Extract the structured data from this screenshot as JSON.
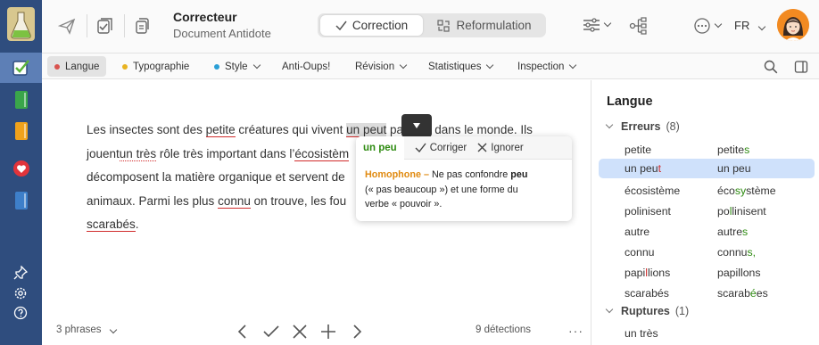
{
  "app": {
    "title": "Correcteur",
    "subtitle": "Document Antidote",
    "language": "FR",
    "accent": "#2f4d7e"
  },
  "modes": {
    "correction": "Correction",
    "reformulation": "Reformulation"
  },
  "tabs": [
    {
      "label": "Langue",
      "dot": "#d9534f",
      "dropdown": false
    },
    {
      "label": "Typographie",
      "dot": "#e8b321",
      "dropdown": false
    },
    {
      "label": "Style",
      "dot": "#2a9fd6",
      "dropdown": true
    },
    {
      "label": "Anti-Oups!",
      "dot": "",
      "dropdown": false
    },
    {
      "label": "Révision",
      "dot": "",
      "dropdown": true
    },
    {
      "label": "Statistiques",
      "dot": "",
      "dropdown": true
    },
    {
      "label": "Inspection",
      "dot": "",
      "dropdown": true
    }
  ],
  "text": {
    "s1": "Les insectes sont des ",
    "w_petite": "petite",
    "s2": " créatures qui vivent ",
    "w_unpeut": "un peut",
    "s3": " pa",
    "s3b": "tout dans le monde. Ils",
    "s4": "jouent",
    "w_untres": "un très",
    "s5": " rôle très important dans l’",
    "w_ecosisteme": "écosistèm",
    "s6": "décomposent la matière organique et servent de",
    "s7": "animaux. Parmi les plus ",
    "w_connu": "connu",
    "s8": " on trouve, les fou",
    "w_scarabes": "scarabés",
    "s9": "."
  },
  "popup": {
    "suggestion": "un peu",
    "fix": "Corriger",
    "ignore": "Ignorer",
    "kind": "Homophone –",
    "msg1": " Ne pas confondre ",
    "msg_word": "peu",
    "msg2": "(« pas beaucoup ») et une forme du",
    "msg3": "verbe « pouvoir »."
  },
  "footer": {
    "phrases": "3 phrases",
    "detections": "9 détections",
    "more": "···"
  },
  "panel": {
    "title": "Langue",
    "errors_label": "Erreurs",
    "errors_count": "(8)",
    "breaks_label": "Ruptures",
    "breaks_count": "(1)",
    "rows": [
      {
        "a": "petite",
        "b_pre": "petite",
        "b_hl": "s",
        "b_post": ""
      },
      {
        "a_pre": "un peu",
        "a_hl": "t",
        "b": "un peu"
      },
      {
        "a": "écosistème",
        "b_pre": "éco",
        "b_hl": "sy",
        "b_post": "stème"
      },
      {
        "a": "polinisent",
        "b_pre": "po",
        "b_hl": "l",
        "b_post": "linisent"
      },
      {
        "a": "autre",
        "b_pre": "autre",
        "b_hl": "s",
        "b_post": ""
      },
      {
        "a": "connu",
        "b_pre": "connu",
        "b_hl": "s",
        "b_post": ","
      },
      {
        "a_pre": "papi",
        "a_hl": "l",
        "a_post": "lions",
        "b": "papillons"
      },
      {
        "a": "scarabés",
        "b_pre": "scarab",
        "b_hl": "é",
        "b_post": "es"
      }
    ],
    "break_row": "un très"
  }
}
